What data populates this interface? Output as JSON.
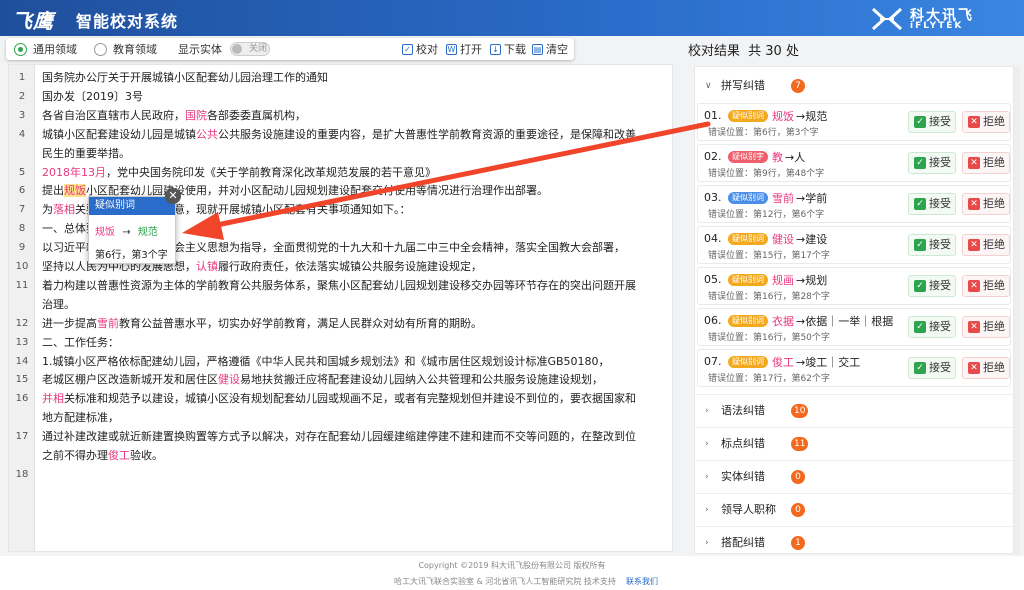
{
  "header": {
    "logo_script": "飞鹰",
    "title": "智能校对系统",
    "brand_cn": "科大讯飞",
    "brand_en": "iFLYTEK"
  },
  "toolbar": {
    "domain_general": "通用领域",
    "domain_education": "教育领域",
    "show_entity": "显示实体",
    "toggle_state": "关闭",
    "proofread": "校对",
    "open": "打开",
    "download": "下载",
    "clear": "清空"
  },
  "document": {
    "lines": [
      {
        "no": "1",
        "text": "国务院办公厅关于开展城镇小区配套幼儿园治理工作的通知"
      },
      {
        "no": "2",
        "text": "国办发〔2019〕3号"
      },
      {
        "no": "3",
        "pre": "各省自治区直辖市人民政府，",
        "err": "国院",
        "post": "各部委委直属机构，"
      },
      {
        "no": "4",
        "pre": "城镇小区配套建设幼儿园是城镇",
        "err": "公共",
        "post": "公共服务设施建设的重要内容，是扩大普惠性学前教育资源的重要途径，是保障和改善"
      },
      {
        "no": "",
        "text": "民生的重要举措。"
      },
      {
        "no": "5",
        "err": "2018年13月",
        "post": "，党中央国务院印发《关于学前教育深化改革规范发展的若干意见》"
      },
      {
        "no": "6",
        "pre": "提出",
        "hl": "规饭",
        "post": "小区配套幼儿园建设使用，并对小区配动儿园规划建设配套交付使用等情况进行治理作出部署。"
      },
      {
        "no": "7",
        "pre": "为",
        "err": "落相",
        "post": "关要求，经国务院同意，现就开展城镇小区配套有关事项通知如下。："
      },
      {
        "no": "8",
        "text": "一、总体要求"
      },
      {
        "no": "9",
        "text": "以习近平新时代中国特色社会主义思想为指导，全面贯彻党的十九大和十九届二中三中全会精神，落实全国教大会部署，"
      },
      {
        "no": "10",
        "pre": "坚持以人民为中心的发展思想，",
        "err": "认镇",
        "post": "履行政府责任，依法落实城镇公共服务设施建设规定，"
      },
      {
        "no": "11",
        "text": "着力构建以普惠性资源为主体的学前教育公共服务体系，聚焦小区配套幼儿园规划建设移交办园等环节存在的突出问题开展"
      },
      {
        "no": "",
        "text": "治理。"
      },
      {
        "no": "12",
        "pre": "进一步提高",
        "err": "雪前",
        "post": "教育公益普惠水平，切实办好学前教育，满足人民群众对幼有所育的期盼。"
      },
      {
        "no": "13",
        "text": "二、工作任务："
      },
      {
        "no": "14",
        "text": "1.城镇小区严格依标配建幼儿园，严格遵循《中华人民共和国城乡规划法》和《城市居住区规划设计标准GB50180，"
      },
      {
        "no": "15",
        "pre": "老城区棚户区改造新城开发和居住区",
        "err": "健设",
        "post": "易地扶贫搬迁应将配套建设幼儿园纳入公共管理和公共服务设施建设规划，"
      },
      {
        "no": "16",
        "pre": "",
        "err": "并相",
        "post": "关标准和规范予以建设，城镇小区没有规划配套幼儿园或规画不足，或者有完整规划但并建设不到位的，要衣据国家和"
      },
      {
        "no": "",
        "text": "地方配建标准，"
      },
      {
        "no": "17",
        "text": "通过补建改建或就近新建置换购置等方式予以解决，对存在配套幼儿园缓建缩建停建不建和建而不交等问题的，在整改到位"
      },
      {
        "no": "",
        "pre": "之前不得办理",
        "err": "俊工",
        "post": "验收。"
      },
      {
        "no": "18",
        "text": ""
      }
    ]
  },
  "popup": {
    "title": "疑似别词",
    "wrong": "规饭",
    "arrow": "→",
    "right": "规范",
    "location": "第6行，第3个字"
  },
  "results": {
    "title": "校对结果",
    "total": "共 30 处",
    "categories": [
      {
        "label": "拼写纠错",
        "count": "7",
        "expanded": true
      },
      {
        "label": "语法纠错",
        "count": "10"
      },
      {
        "label": "标点纠错",
        "count": "11"
      },
      {
        "label": "实体纠错",
        "count": "0"
      },
      {
        "label": "领导人职称",
        "count": "0"
      },
      {
        "label": "搭配纠错",
        "count": "1"
      }
    ],
    "items": [
      {
        "no": "01.",
        "tag": "疑似别词",
        "tag_color": "yellow",
        "wrong": "规饭",
        "right": "→规范",
        "loc": "错误位置：第6行，第3个字"
      },
      {
        "no": "02.",
        "tag": "疑似别字",
        "tag_color": "red",
        "wrong": "教",
        "right": "→人",
        "loc": "错误位置：第9行，第48个字"
      },
      {
        "no": "03.",
        "tag": "疑似别词",
        "tag_color": "blue",
        "wrong": "雪前",
        "right": "→学前",
        "loc": "错误位置：第12行，第6个字"
      },
      {
        "no": "04.",
        "tag": "疑似别词",
        "tag_color": "yellow",
        "wrong": "健设",
        "right": "→建设",
        "loc": "错误位置：第15行，第17个字"
      },
      {
        "no": "05.",
        "tag": "疑似别词",
        "tag_color": "yellow",
        "wrong": "规画",
        "right": "→规划",
        "loc": "错误位置：第16行，第28个字"
      },
      {
        "no": "06.",
        "tag": "疑似别词",
        "tag_color": "yellow",
        "wrong": "衣据",
        "right": "→依据｜一举｜根据",
        "loc": "错误位置：第16行，第50个字"
      },
      {
        "no": "07.",
        "tag": "疑似别词",
        "tag_color": "yellow",
        "wrong": "俊工",
        "right": "→竣工｜交工",
        "loc": "错误位置：第17行，第62个字"
      }
    ],
    "accept": "接受",
    "reject": "拒绝"
  },
  "footer": {
    "copyright": "Copyright ©2019 科大讯飞股份有限公司 版权所有",
    "support": "哈工大讯飞联合实验室 & 河北省讯飞人工智能研究院  技术支持",
    "contact": "联系我们"
  },
  "colors": {
    "header_blue": "#2a6cc9",
    "error_pink": "#e8387f",
    "highlight_yellow": "#ffe28a",
    "badge_orange": "#f36a1f",
    "accept_green": "#2fa44f",
    "reject_red": "#e84a4a",
    "arrow_red": "#f0452b"
  }
}
